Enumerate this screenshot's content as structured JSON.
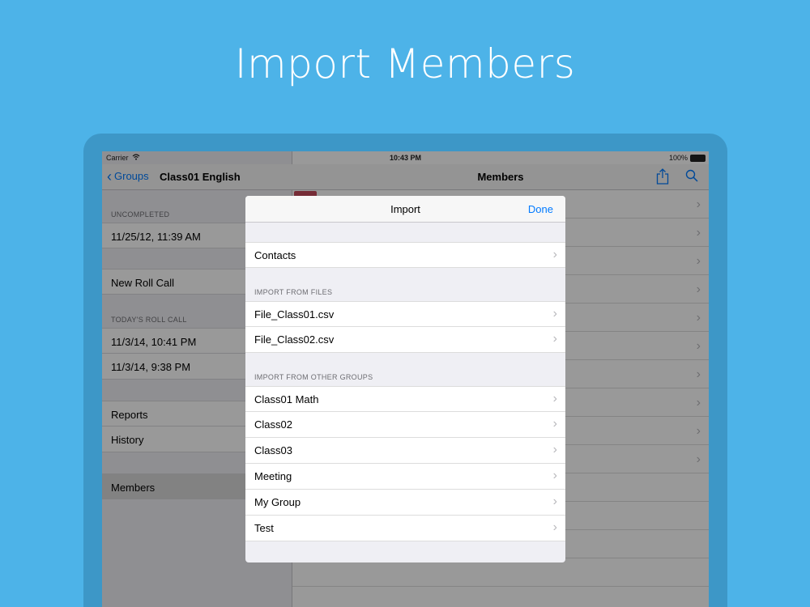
{
  "headline": "Import Members",
  "status_bar": {
    "carrier": "Carrier",
    "time": "10:43 PM",
    "battery": "100%"
  },
  "master": {
    "back_label": "Groups",
    "title": "Class01 English",
    "uncompleted_header": "UNCOMPLETED",
    "uncompleted_items": [
      "11/25/12, 11:39 AM"
    ],
    "new_roll_call": "New Roll Call",
    "today_header": "TODAY'S ROLL CALL",
    "today_items": [
      "11/3/14, 10:41 PM",
      "11/3/14, 9:38 PM"
    ],
    "reports": "Reports",
    "history": "History",
    "members": "Members"
  },
  "detail": {
    "title": "Members"
  },
  "modal": {
    "title": "Import",
    "done_label": "Done",
    "contacts": "Contacts",
    "files_header": "IMPORT FROM FILES",
    "files": [
      "File_Class01.csv",
      "File_Class02.csv"
    ],
    "groups_header": "IMPORT FROM OTHER GROUPS",
    "groups": [
      "Class01 Math",
      "Class02",
      "Class03",
      "Meeting",
      "My Group",
      "Test"
    ]
  },
  "icons": {
    "back": "chevron-left-icon",
    "share": "share-icon",
    "search": "search-icon",
    "disclosure": "chevron-right-icon",
    "wifi": "wifi-icon",
    "battery": "battery-icon"
  },
  "colors": {
    "background": "#4db3e8",
    "device": "#3d97c7",
    "accent": "#007aff"
  }
}
